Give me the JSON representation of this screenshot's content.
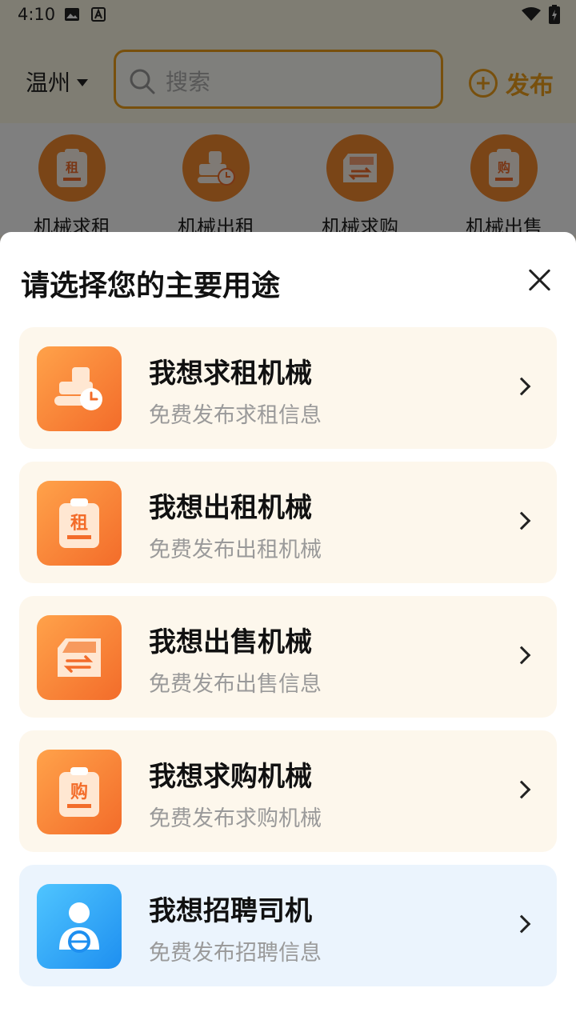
{
  "status_bar": {
    "time": "4:10",
    "icons": [
      "image-icon",
      "text-icon",
      "wifi-icon",
      "battery-icon"
    ]
  },
  "header": {
    "city": "温州",
    "search_placeholder": "搜索",
    "publish_label": "发布"
  },
  "categories": [
    {
      "label": "机械求租",
      "icon": "clipboard-rent-icon"
    },
    {
      "label": "机械出租",
      "icon": "excavator-icon"
    },
    {
      "label": "机械求购",
      "icon": "exchange-icon"
    },
    {
      "label": "机械出售",
      "icon": "clipboard-buy-icon"
    }
  ],
  "sheet": {
    "title": "请选择您的主要用途",
    "options": [
      {
        "title": "我想求租机械",
        "subtitle": "免费发布求租信息",
        "icon": "excavator-clock-icon"
      },
      {
        "title": "我想出租机械",
        "subtitle": "免费发布出租机械",
        "icon": "clipboard-rent-icon",
        "glyph": "租"
      },
      {
        "title": "我想出售机械",
        "subtitle": "免费发布出售信息",
        "icon": "exchange-card-icon"
      },
      {
        "title": "我想求购机械",
        "subtitle": "免费发布求购机械",
        "icon": "clipboard-buy-icon",
        "glyph": "购"
      },
      {
        "title": "我想招聘司机",
        "subtitle": "免费发布招聘信息",
        "icon": "driver-icon"
      }
    ]
  },
  "colors": {
    "accent": "#f0a01a",
    "orange_icon": "#f36c2a",
    "blue_icon": "#1e8ff0",
    "option_bg": "#fdf7ec",
    "option_bg_blue": "#ebf4fd"
  }
}
